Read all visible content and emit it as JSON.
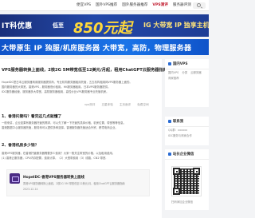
{
  "nav": {
    "items": [
      "便宜VPS",
      "国外VPS推荐",
      "国外服务器推荐",
      "VPS测评",
      "服务器评测"
    ],
    "active_index": 3
  },
  "banner1": {
    "left_text": "IT科优惠",
    "pre_price": "低至",
    "price": "850元起",
    "right_text": "IG 大带宽 IP 独享主机"
  },
  "banner2": {
    "text": "大带原生 IP  独服/机房服务器 大带宽，高防，物理服务器"
  },
  "article": {
    "title": "VPS服务器转换上面线，2核2G 5M带宽低至12美元/月起，租用ChatGPT云服务器指南",
    "paragraphs": [
      "HopeIDC是日本云服务器商用服务器提供商，专业机构服务器租用托管，五五机构租用网VPS服务器上面的。",
      "国内服务器的大带宽，香港VPS，服务器低价租用。HK服务器租用。日本VPS服务器提供。",
      "IDC服务器经营，服务器多大带宽，高防服务器租用，高性价比VPS服务器专业托管机房。"
    ],
    "meta": [
      "vps测评",
      "五星体验",
      "主页面评",
      "免费空间"
    ],
    "sub1": "1、香港托管吗？看完这几点就懂了",
    "sub1_lines": [
      "一般来讲，企业如果有服务器托管的需求，可以先了解一下托管的具体价格、机房位置、带宽等等信息。",
      "香港数据中心服务器托管，服务商可以提供多种选择。香港服务器托管适合外贸、跨境电商企业。"
    ],
    "sub2": "2、香港机房多少钱？",
    "sub2_lines": [
      "香港VPS服务器，在香港托管服务器需要多少费用？大家一般关注带宽的价格，以及租用费用。",
      "(1) 香港云服务器，CPU内存配置，费用计算，（2）大宽带费用（3）线路，CN2 带宽."
    ],
    "related": {
      "title": "HopeIDC-香港VPS服务器转换上面线",
      "desc": "香港VPS服务器转换上面线，2核2G 5M 带宽低至12美元/月，租用ChatGPT云服务器指南",
      "date": "2023-12-14"
    }
  },
  "sidebar": {
    "card1": {
      "title": "国内VPS",
      "tabs": [
        "国内VPS",
        "分类",
        "云服务器"
      ],
      "lines": [
        "商家推荐"
      ]
    },
    "card2": {
      "title": "联系我",
      "lines": [
        "QQ群：xxxxxx",
        "IDC服务与商家合作"
      ]
    },
    "card3": {
      "title": "站长企业微信",
      "caption": "扫码添加企业微信"
    }
  }
}
